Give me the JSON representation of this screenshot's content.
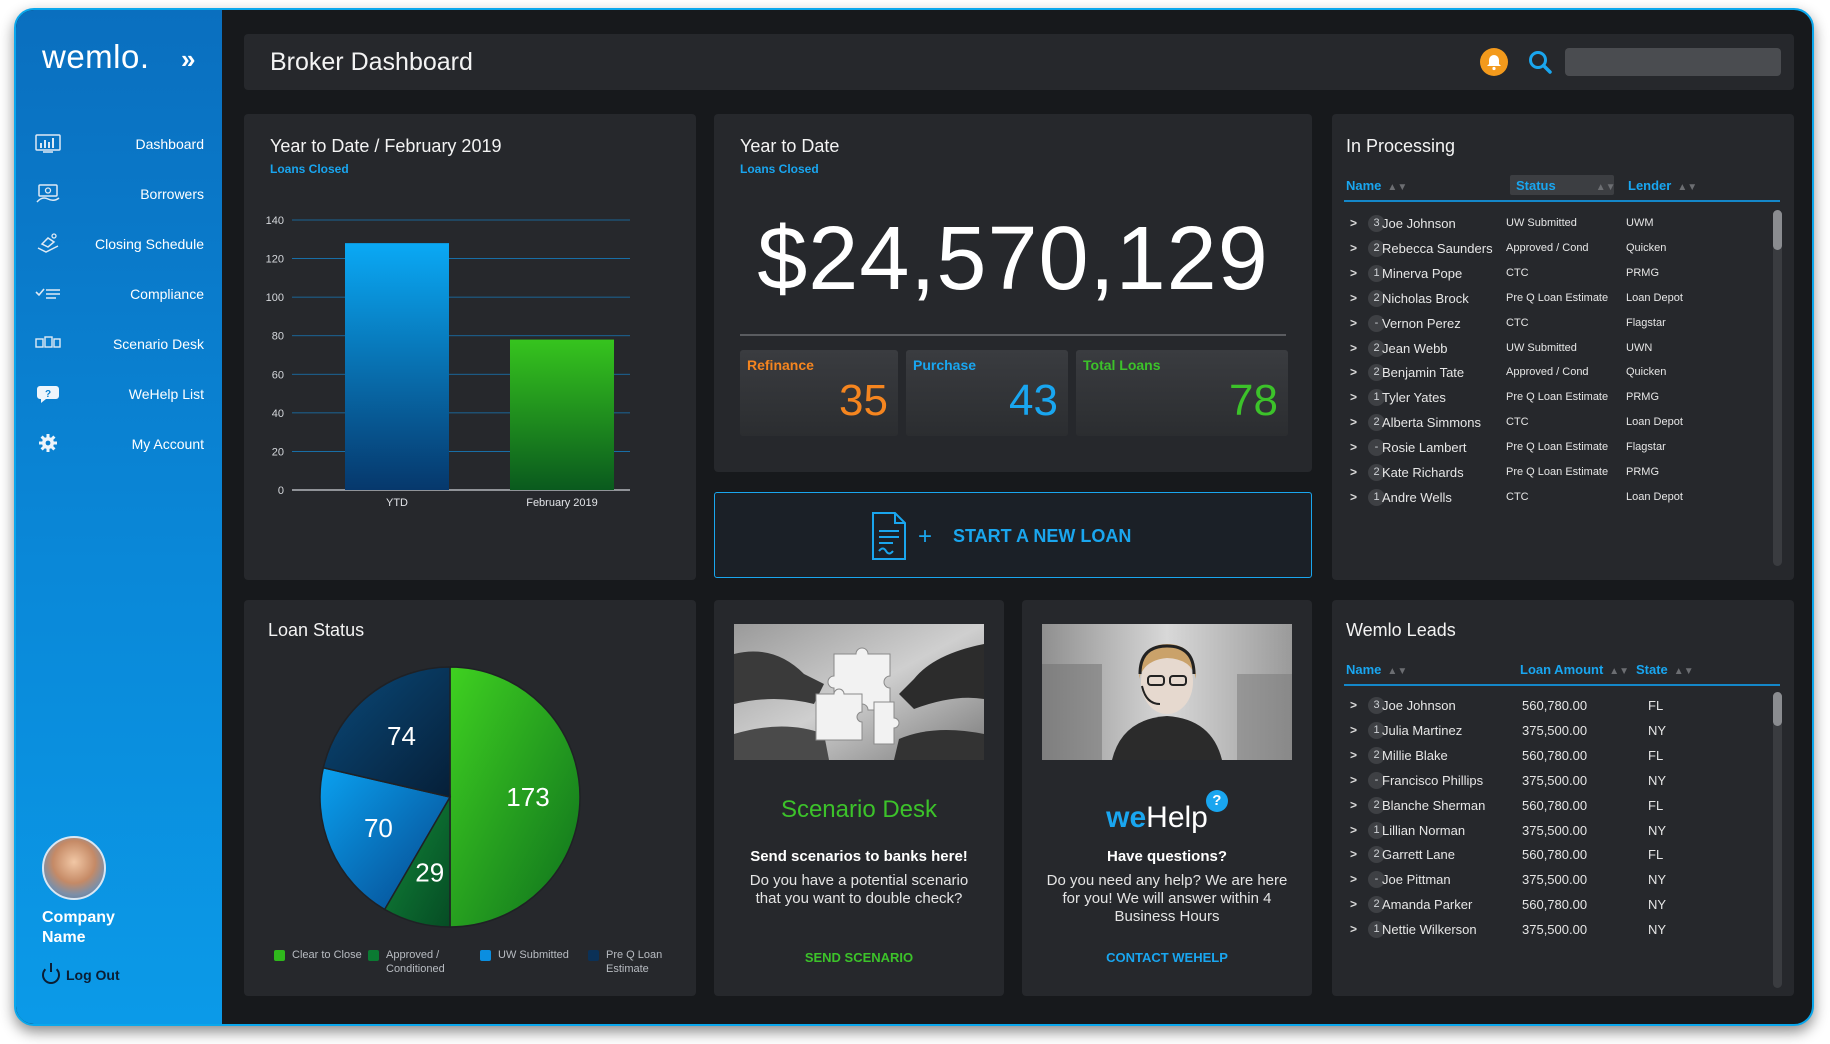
{
  "sidebar": {
    "logo": "wemlo.",
    "logo_chevron": "»",
    "items": [
      {
        "label": "Dashboard",
        "icon": "dashboard-icon"
      },
      {
        "label": "Borrowers",
        "icon": "borrowers-icon"
      },
      {
        "label": "Closing Schedule",
        "icon": "closing-schedule-icon"
      },
      {
        "label": "Compliance",
        "icon": "compliance-icon"
      },
      {
        "label": "Scenario Desk",
        "icon": "scenario-desk-icon"
      },
      {
        "label": "WeHelp List",
        "icon": "help-icon"
      },
      {
        "label": "My Account",
        "icon": "gear-icon"
      }
    ],
    "company": "Company Name",
    "logout": "Log Out"
  },
  "header": {
    "title": "Broker Dashboard",
    "search_value": ""
  },
  "ytd_feb": {
    "title": "Year to Date / February 2019",
    "subtitle": "Loans Closed"
  },
  "chart_data": [
    {
      "type": "bar",
      "title": "Year to Date / February 2019",
      "subtitle": "Loans Closed",
      "categories": [
        "YTD",
        "February 2019"
      ],
      "values": [
        128,
        78
      ],
      "colors": [
        "#0a9ef0",
        "#2fb81c"
      ],
      "ylim": [
        0,
        140
      ],
      "yticks": [
        0,
        20,
        40,
        60,
        80,
        100,
        120,
        140
      ],
      "grid": true
    },
    {
      "type": "pie",
      "title": "Loan Status",
      "slices": [
        {
          "label": "Clear to Close",
          "value": 173,
          "color": "#2fb81c"
        },
        {
          "label": "Approved / Conditioned",
          "value": 29,
          "color": "#0b7a32"
        },
        {
          "label": "UW Submitted",
          "value": 70,
          "color": "#0a8ee0"
        },
        {
          "label": "Pre Q Loan Estimate",
          "value": 74,
          "color": "#0b3157"
        }
      ],
      "legend_position": "bottom"
    }
  ],
  "ytd": {
    "title": "Year to Date",
    "subtitle": "Loans Closed",
    "amount": "$24,570,129",
    "refinance_label": "Refinance",
    "refinance_value": "35",
    "purchase_label": "Purchase",
    "purchase_value": "43",
    "total_label": "Total Loans",
    "total_value": "78"
  },
  "start_loan": {
    "label": "START A NEW LOAN"
  },
  "processing": {
    "title": "In Processing",
    "columns": [
      "Name",
      "Status",
      "Lender"
    ],
    "rows": [
      {
        "badge": "3",
        "name": "Joe Johnson",
        "status": "UW Submitted",
        "lender": "UWM"
      },
      {
        "badge": "2",
        "name": "Rebecca Saunders",
        "status": "Approved / Cond",
        "lender": "Quicken"
      },
      {
        "badge": "1",
        "name": "Minerva Pope",
        "status": "CTC",
        "lender": "PRMG"
      },
      {
        "badge": "2",
        "name": "Nicholas Brock",
        "status": "Pre Q Loan Estimate",
        "lender": "Loan Depot"
      },
      {
        "badge": "-",
        "name": "Vernon Perez",
        "status": "CTC",
        "lender": "Flagstar"
      },
      {
        "badge": "2",
        "name": "Jean Webb",
        "status": "UW Submitted",
        "lender": "UWN"
      },
      {
        "badge": "2",
        "name": "Benjamin Tate",
        "status": "Approved / Cond",
        "lender": "Quicken"
      },
      {
        "badge": "1",
        "name": "Tyler Yates",
        "status": "Pre Q Loan Estimate",
        "lender": "PRMG"
      },
      {
        "badge": "2",
        "name": "Alberta Simmons",
        "status": "CTC",
        "lender": "Loan Depot"
      },
      {
        "badge": "-",
        "name": "Rosie Lambert",
        "status": "Pre Q Loan Estimate",
        "lender": "Flagstar"
      },
      {
        "badge": "2",
        "name": "Kate Richards",
        "status": "Pre Q Loan Estimate",
        "lender": "PRMG"
      },
      {
        "badge": "1",
        "name": "Andre Wells",
        "status": "CTC",
        "lender": "Loan Depot"
      }
    ]
  },
  "loan_status": {
    "title": "Loan Status",
    "legend": [
      "Clear to Close",
      "Approved / Conditioned",
      "UW Submitted",
      "Pre Q Loan Estimate"
    ]
  },
  "scenario": {
    "title": "Scenario Desk",
    "heading": "Send scenarios to banks here!",
    "body": "Do you have a potential scenario that you want to double check?",
    "link": "SEND SCENARIO"
  },
  "wehelp": {
    "title_we": "we",
    "title_help": "Help",
    "badge": "?",
    "heading": "Have questions?",
    "body": "Do you need any help? We are here for you! We will answer within 4 Business Hours",
    "link": "CONTACT WEHELP"
  },
  "leads": {
    "title": "Wemlo Leads",
    "columns": [
      "Name",
      "Loan Amount",
      "State"
    ],
    "rows": [
      {
        "badge": "3",
        "name": "Joe Johnson",
        "amount": "560,780.00",
        "state": "FL"
      },
      {
        "badge": "1",
        "name": "Julia Martinez",
        "amount": "375,500.00",
        "state": "NY"
      },
      {
        "badge": "2",
        "name": "Millie Blake",
        "amount": "560,780.00",
        "state": "FL"
      },
      {
        "badge": "-",
        "name": "Francisco Phillips",
        "amount": "375,500.00",
        "state": "NY"
      },
      {
        "badge": "2",
        "name": "Blanche Sherman",
        "amount": "560,780.00",
        "state": "FL"
      },
      {
        "badge": "1",
        "name": "Lillian Norman",
        "amount": "375,500.00",
        "state": "NY"
      },
      {
        "badge": "2",
        "name": "Garrett Lane",
        "amount": "560,780.00",
        "state": "FL"
      },
      {
        "badge": "-",
        "name": "Joe Pittman",
        "amount": "375,500.00",
        "state": "NY"
      },
      {
        "badge": "2",
        "name": "Amanda Parker",
        "amount": "560,780.00",
        "state": "NY"
      },
      {
        "badge": "1",
        "name": "Nettie Wilkerson",
        "amount": "375,500.00",
        "state": "NY"
      }
    ]
  }
}
